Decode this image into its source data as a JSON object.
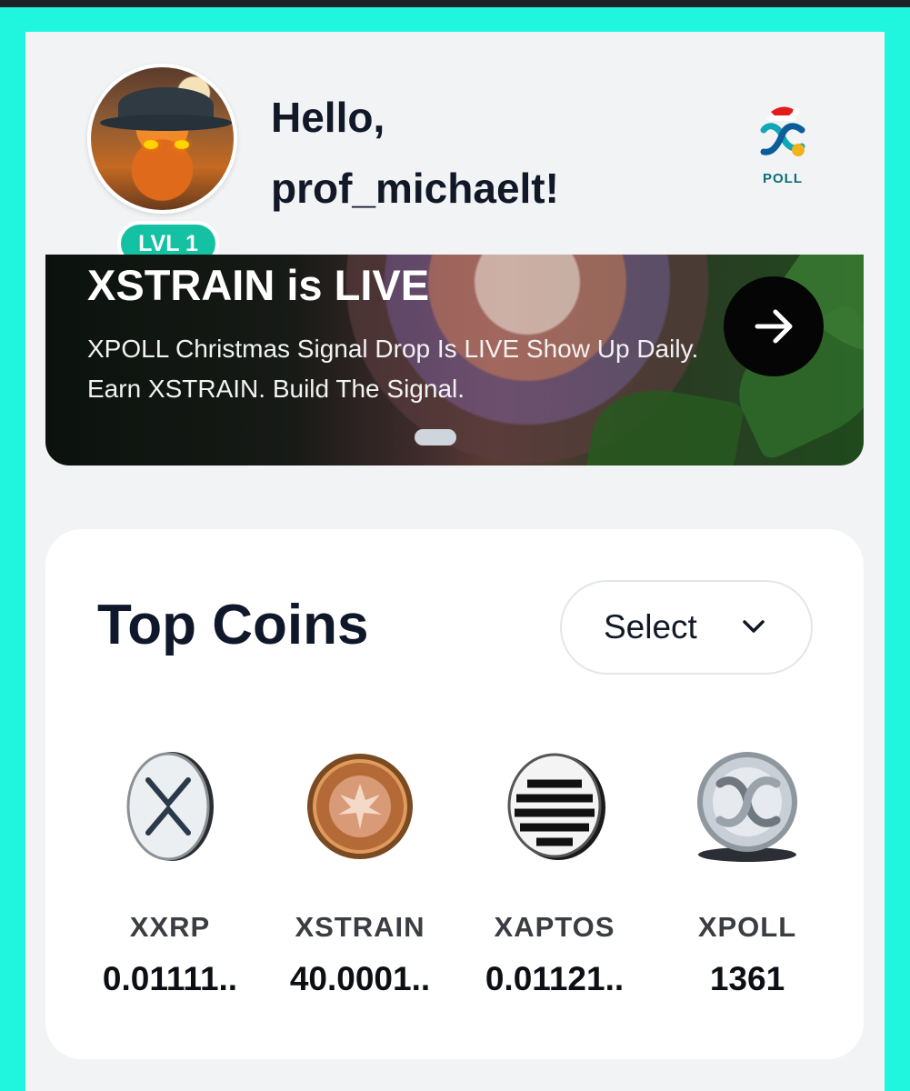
{
  "header": {
    "level_badge": "LVL 1",
    "greeting_line1": "Hello,",
    "greeting_line2": "prof_michaelt!",
    "logo_text": "POLL",
    "avatar_icon": "octopus-witch-avatar",
    "logo_icon": "xpoll-logo-santa-hat"
  },
  "banner": {
    "title": "XSTRAIN is LIVE",
    "text": "XPOLL Christmas Signal Drop Is LIVE Show Up Daily. Earn XSTRAIN. Build The Signal.",
    "arrow_icon": "arrow-right-icon",
    "carousel_dots": 1
  },
  "top_coins": {
    "title": "Top Coins",
    "select": {
      "label": "Select",
      "icon": "chevron-down-icon"
    },
    "coins": [
      {
        "name": "XXRP",
        "value": "0.01111..",
        "icon": "xrp-coin-icon"
      },
      {
        "name": "XSTRAIN",
        "value": "40.0001..",
        "icon": "xstrain-coin-icon"
      },
      {
        "name": "XAPTOS",
        "value": "0.01121..",
        "icon": "aptos-coin-icon"
      },
      {
        "name": "XPOLL",
        "value": "1361",
        "icon": "xpoll-coin-icon"
      }
    ]
  },
  "colors": {
    "frame_bg": "#20f5dd",
    "app_bg": "#f1f3f5",
    "level_badge": "#15c1a3",
    "text_dark": "#111827"
  }
}
